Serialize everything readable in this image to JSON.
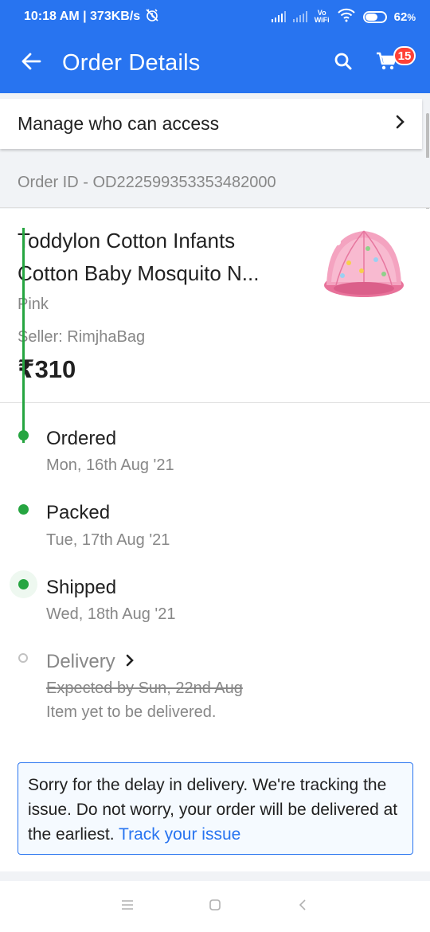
{
  "status_bar": {
    "time_speed": "10:18 AM | 373KB/s",
    "vowifi_top": "Vo",
    "vowifi_bottom": "WiFi",
    "battery_percent": "62",
    "battery_suffix": "%",
    "battery_level": 0.62,
    "icons": [
      "alarm-off-icon",
      "signal-icon",
      "signal-icon",
      "vowifi-icon",
      "wifi-icon",
      "battery-icon"
    ]
  },
  "header": {
    "title": "Order Details",
    "cart_count": "15",
    "icons": [
      "back-arrow-icon",
      "search-icon",
      "cart-icon"
    ],
    "color": "#2874f0"
  },
  "manage_access": {
    "label": "Manage who can access",
    "icon": "chevron-right-icon"
  },
  "order": {
    "id_text": "Order ID - OD222599353353482000"
  },
  "product": {
    "name_line1": "Toddylon Cotton Infants",
    "name_line2": "Cotton Baby Mosquito N...",
    "color": "Pink",
    "seller": "Seller: RimjhaBag",
    "price": "₹310"
  },
  "timeline": {
    "steps": [
      {
        "title": "Ordered",
        "date": "Mon, 16th Aug '21",
        "status": "done"
      },
      {
        "title": "Packed",
        "date": "Tue, 17th Aug '21",
        "status": "done"
      },
      {
        "title": "Shipped",
        "date": "Wed, 18th Aug '21",
        "status": "done"
      },
      {
        "title": "Delivery",
        "expected": "Expected by Sun, 22nd Aug",
        "note": "Item yet to be delivered.",
        "status": "pending"
      }
    ],
    "accent": "#26a541"
  },
  "notice": {
    "text": "Sorry for the delay in delivery. We're tracking the issue. Do not worry, your order will be delivered at the earliest.",
    "link": "Track your issue"
  },
  "nav_bar": {
    "icons": [
      "menu-icon",
      "home-square-icon",
      "back-icon"
    ]
  }
}
